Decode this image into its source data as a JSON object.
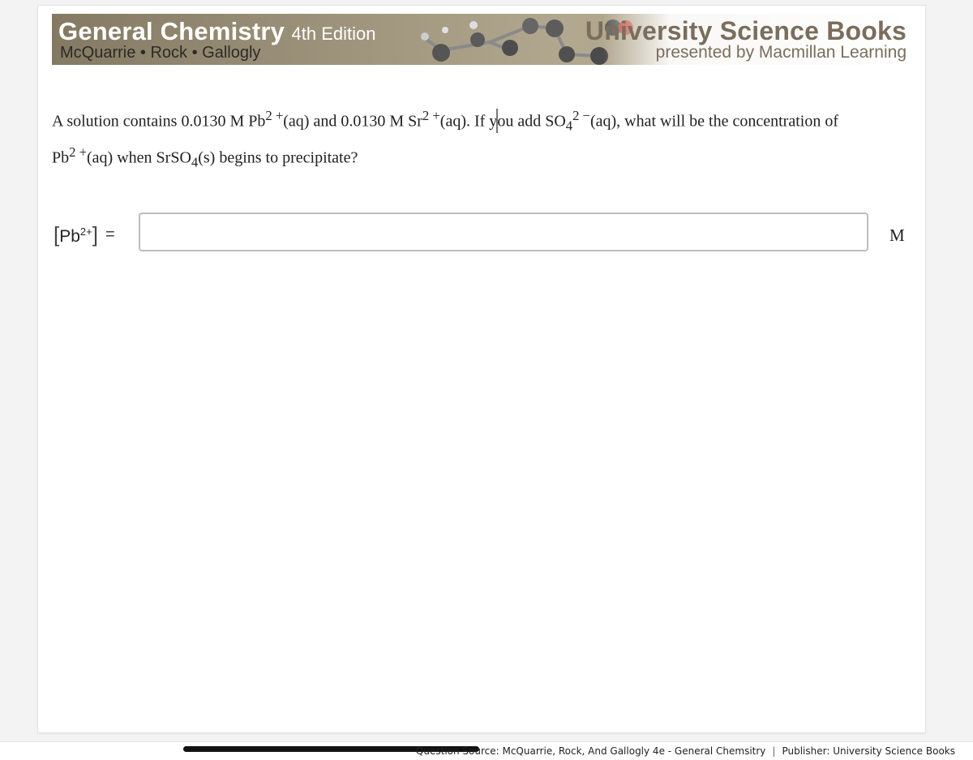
{
  "banner": {
    "title": "General Chemistry",
    "edition": "4th Edition",
    "authors": "McQuarrie • Rock • Gallogly",
    "publisher": "University Science Books",
    "publisher_sub": "presented by Macmillan Learning"
  },
  "question": {
    "part1": "A solution contains 0.0130 M Pb",
    "sup1": "2 +",
    "part2": "(aq) and 0.0130 M Sr",
    "sup2": "2 +",
    "part3": "(aq). If y",
    "part3b": "ou add SO",
    "sub3": "4",
    "sup3": "2 −",
    "part4": "(aq), what will be the concentration of",
    "part5": "Pb",
    "sup5": "2 +",
    "part6": "(aq) when SrSO",
    "sub6": "4",
    "part7": "(s) begins to precipitate?"
  },
  "answer": {
    "label_ion": "Pb",
    "label_charge": "2+",
    "equals": "=",
    "value": "",
    "unit": "M"
  },
  "footer": {
    "source": "Question Source: McQuarrie, Rock, And Gallogly 4e - General Chemsitry",
    "separator": "|",
    "publisher": "Publisher: University Science Books"
  },
  "colors": {
    "banner_bg": "#a1977f",
    "publisher_text": "#7b6d5c",
    "input_border": "#bdbdbd"
  }
}
